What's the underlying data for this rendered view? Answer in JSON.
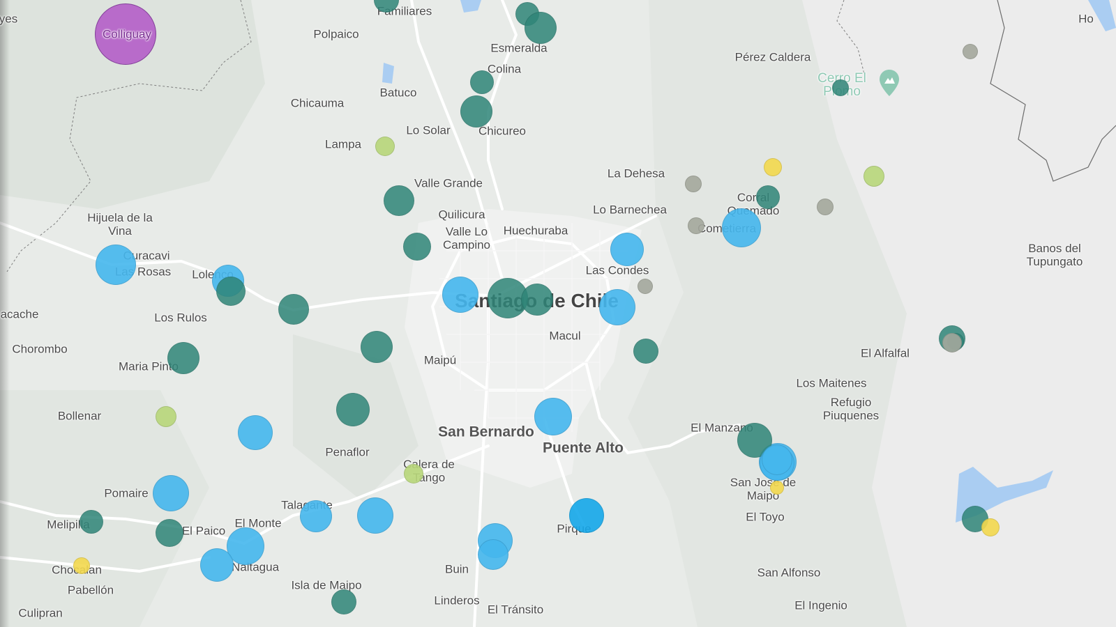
{
  "map": {
    "colors": {
      "land": "#e8ebe8",
      "terrain": "#d9dfd9",
      "mountain": "#eeeeee",
      "road": "#ffffff",
      "border": "#6b6b6b",
      "water": "#aacdf2"
    },
    "labels": [
      {
        "text": "yes",
        "style": "normal"
      },
      {
        "text": "Familiares",
        "style": "normal"
      },
      {
        "text": "Polpaico",
        "style": "normal"
      },
      {
        "text": "Esmeralda",
        "style": "normal"
      },
      {
        "text": "Colina",
        "style": "normal"
      },
      {
        "text": "Pérez Caldera",
        "style": "normal"
      },
      {
        "text": "Cerro El Plomo",
        "style": "park"
      },
      {
        "text": "Batuco",
        "style": "normal"
      },
      {
        "text": "Chicauma",
        "style": "normal"
      },
      {
        "text": "Lo Solar",
        "style": "normal"
      },
      {
        "text": "Chicureo",
        "style": "normal"
      },
      {
        "text": "Lampa",
        "style": "normal"
      },
      {
        "text": "La Dehesa",
        "style": "normal"
      },
      {
        "text": "Valle Grande",
        "style": "normal"
      },
      {
        "text": "Corral Quemado",
        "style": "wrap"
      },
      {
        "text": "Lo Barnechea",
        "style": "normal"
      },
      {
        "text": "Quilicura",
        "style": "normal"
      },
      {
        "text": "Hijuela de la Vina",
        "style": "wrap"
      },
      {
        "text": "Valle Lo Campino",
        "style": "wrap"
      },
      {
        "text": "Huechuraba",
        "style": "normal"
      },
      {
        "text": "Cometierra",
        "style": "normal"
      },
      {
        "text": "Curacavi",
        "style": "normal"
      },
      {
        "text": "Las Rosas",
        "style": "normal"
      },
      {
        "text": "Lolenco",
        "style": "normal"
      },
      {
        "text": "Las Condes",
        "style": "normal"
      },
      {
        "text": "Banos del Tupungato",
        "style": "wrap"
      },
      {
        "text": "Santiago de Chile",
        "style": "big"
      },
      {
        "text": "acache",
        "style": "normal"
      },
      {
        "text": "Los Rulos",
        "style": "normal"
      },
      {
        "text": "Macul",
        "style": "normal"
      },
      {
        "text": "Chorombo",
        "style": "normal"
      },
      {
        "text": "El Alfalfal",
        "style": "normal"
      },
      {
        "text": "Maipú",
        "style": "normal"
      },
      {
        "text": "Maria Pinto",
        "style": "normal"
      },
      {
        "text": "Los Maitenes",
        "style": "normal"
      },
      {
        "text": "Refugio Piuquenes",
        "style": "wrap"
      },
      {
        "text": "Bollenar",
        "style": "normal"
      },
      {
        "text": "San Bernardo",
        "style": "mid"
      },
      {
        "text": "El Manzano",
        "style": "normal"
      },
      {
        "text": "Puente Alto",
        "style": "mid"
      },
      {
        "text": "Penaflor",
        "style": "normal"
      },
      {
        "text": "Calera de Tango",
        "style": "wrap"
      },
      {
        "text": "San José de Maipo",
        "style": "wrap"
      },
      {
        "text": "Pomaire",
        "style": "normal"
      },
      {
        "text": "Talagante",
        "style": "normal"
      },
      {
        "text": "El Toyo",
        "style": "normal"
      },
      {
        "text": "Melipilla",
        "style": "normal"
      },
      {
        "text": "El Monte",
        "style": "normal"
      },
      {
        "text": "El Paico",
        "style": "normal"
      },
      {
        "text": "Pirque",
        "style": "normal"
      },
      {
        "text": "Chocalan",
        "style": "normal"
      },
      {
        "text": "Naltagua",
        "style": "normal"
      },
      {
        "text": "Buin",
        "style": "normal"
      },
      {
        "text": "San Alfonso",
        "style": "normal"
      },
      {
        "text": "Pabellón",
        "style": "normal"
      },
      {
        "text": "Isla de Maipo",
        "style": "normal"
      },
      {
        "text": "Linderos",
        "style": "normal"
      },
      {
        "text": "El Tránsito",
        "style": "normal"
      },
      {
        "text": "El Ingenio",
        "style": "normal"
      },
      {
        "text": "Culipran",
        "style": "normal"
      },
      {
        "text": "Colliguay",
        "style": "marker"
      },
      {
        "text": "Ho",
        "style": "normal"
      }
    ],
    "markers": [
      {
        "place": "Colliguay",
        "color": "purple"
      },
      {
        "color": "teal"
      },
      {
        "color": "teal"
      },
      {
        "color": "teal"
      },
      {
        "color": "teal"
      },
      {
        "color": "teal"
      },
      {
        "color": "lime"
      },
      {
        "color": "teal"
      },
      {
        "color": "teal"
      },
      {
        "color": "blue"
      },
      {
        "color": "blue"
      },
      {
        "color": "teal"
      },
      {
        "color": "teal"
      },
      {
        "color": "blue"
      },
      {
        "color": "teal"
      },
      {
        "color": "teal"
      },
      {
        "color": "blue"
      },
      {
        "color": "blue"
      },
      {
        "color": "gray"
      },
      {
        "color": "teal"
      },
      {
        "color": "teal"
      },
      {
        "color": "teal"
      },
      {
        "color": "lime"
      },
      {
        "color": "blue"
      },
      {
        "color": "teal"
      },
      {
        "color": "blue"
      },
      {
        "color": "blue"
      },
      {
        "color": "teal"
      },
      {
        "color": "teal"
      },
      {
        "color": "blue"
      },
      {
        "color": "blue"
      },
      {
        "color": "blue"
      },
      {
        "color": "blue"
      },
      {
        "color": "yellow"
      },
      {
        "color": "lime"
      },
      {
        "color": "blue"
      },
      {
        "color": "brightblue"
      },
      {
        "color": "blue"
      },
      {
        "color": "blue"
      },
      {
        "color": "teal"
      },
      {
        "color": "teal"
      },
      {
        "color": "gray"
      },
      {
        "color": "gray"
      },
      {
        "color": "yellow"
      },
      {
        "color": "lime"
      },
      {
        "color": "teal"
      },
      {
        "color": "gray"
      },
      {
        "color": "gray"
      },
      {
        "color": "blue"
      },
      {
        "color": "teal"
      },
      {
        "color": "blue"
      },
      {
        "color": "blue"
      },
      {
        "color": "yellow"
      },
      {
        "color": "teal"
      },
      {
        "color": "yellow"
      },
      {
        "color": "teal"
      },
      {
        "color": "teal"
      },
      {
        "color": "gray"
      }
    ],
    "marker_colors": {
      "purple": "#b45fc9",
      "teal": "#2f8578",
      "blue": "#45b7ee",
      "brightblue": "#15a8ea",
      "lime": "#b8d77a",
      "yellow": "#f3d94e",
      "gray": "#a4a89d"
    }
  }
}
